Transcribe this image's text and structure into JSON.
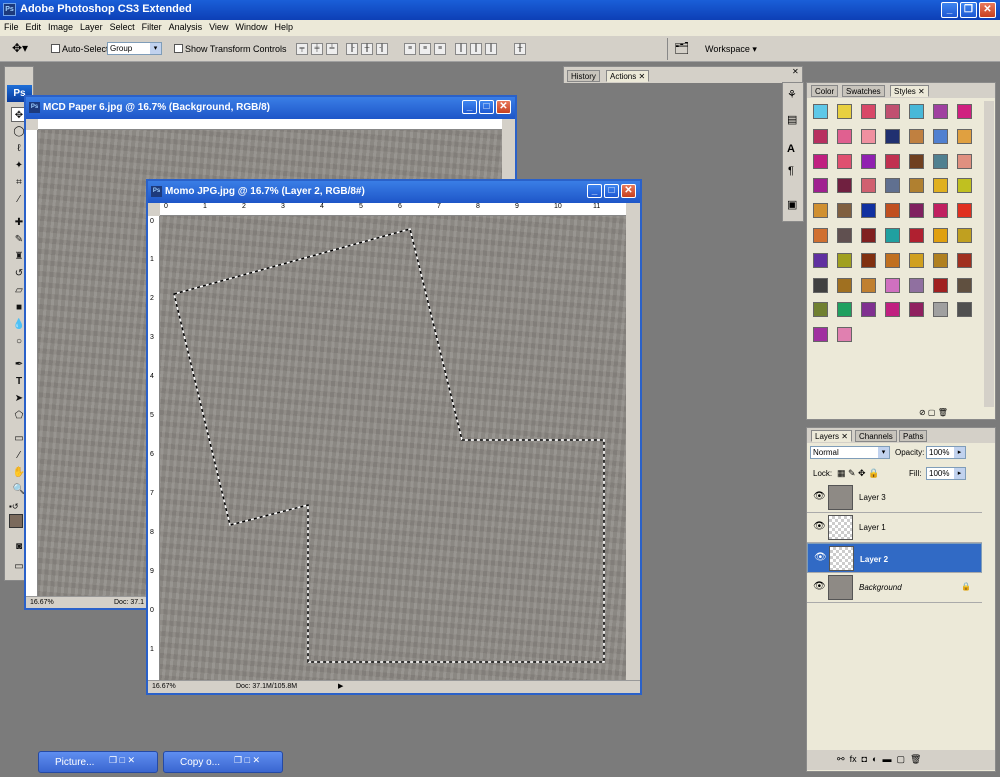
{
  "app": {
    "title": "Adobe Photoshop CS3 Extended",
    "logo": "Ps"
  },
  "menu": [
    "File",
    "Edit",
    "Image",
    "Layer",
    "Select",
    "Filter",
    "Analysis",
    "View",
    "Window",
    "Help"
  ],
  "options": {
    "auto_select_label": "Auto-Select:",
    "auto_select_value": "Group",
    "show_transform_label": "Show Transform Controls",
    "workspace_label": "Workspace"
  },
  "history_panel": {
    "tabs": [
      "History",
      "Actions"
    ]
  },
  "color_panel": {
    "tabs": [
      "Color",
      "Swatches",
      "Styles"
    ]
  },
  "layers_panel": {
    "tabs": [
      "Layers",
      "Channels",
      "Paths"
    ],
    "blend_mode": "Normal",
    "opacity_label": "Opacity:",
    "opacity_value": "100%",
    "lock_label": "Lock:",
    "fill_label": "Fill:",
    "fill_value": "100%",
    "layers": [
      {
        "name": "Layer 3",
        "selected": false
      },
      {
        "name": "Layer 1",
        "selected": false
      },
      {
        "name": "Layer 2",
        "selected": true
      },
      {
        "name": "Background",
        "selected": false
      }
    ]
  },
  "doc1": {
    "title": "MCD Paper 6.jpg @ 16.7% (Background, RGB/8)",
    "zoom": "16.67%",
    "doc": "Doc: 37.1"
  },
  "doc2": {
    "title": "Momo JPG.jpg @ 16.7% (Layer 2, RGB/8#)",
    "zoom": "16.67%",
    "doc": "Doc: 37.1M/105.8M"
  },
  "ruler_h": [
    "0",
    "1",
    "2",
    "3",
    "4",
    "5",
    "6",
    "7",
    "8",
    "9",
    "10",
    "11"
  ],
  "ruler_v": [
    "0",
    "1",
    "2",
    "3",
    "4",
    "5",
    "6",
    "7",
    "8",
    "9",
    "0",
    "1"
  ],
  "taskbar": [
    {
      "label": "Picture..."
    },
    {
      "label": "Copy o..."
    }
  ],
  "colors": {
    "accent": "#316ac5",
    "foreground": "#7b6a5c",
    "canvas": "#8e8a85"
  }
}
